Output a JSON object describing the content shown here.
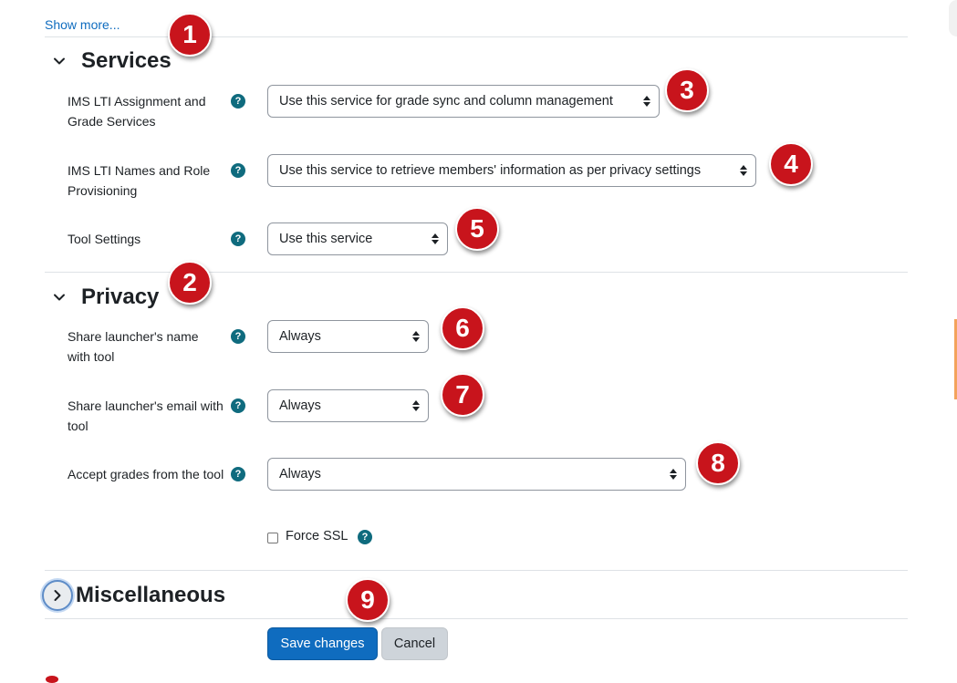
{
  "show_more": "Show more...",
  "sections": {
    "services": {
      "title": "Services"
    },
    "privacy": {
      "title": "Privacy"
    },
    "misc": {
      "title": "Miscellaneous"
    }
  },
  "services": {
    "grade_services": {
      "label": "IMS LTI Assignment and Grade Services",
      "value": "Use this service for grade sync and column management"
    },
    "names_roles": {
      "label": "IMS LTI Names and Role Provisioning",
      "value": "Use this service to retrieve members' information as per privacy settings"
    },
    "tool_settings": {
      "label": "Tool Settings",
      "value": "Use this service"
    }
  },
  "privacy": {
    "share_name": {
      "label": "Share launcher's name with tool",
      "value": "Always"
    },
    "share_email": {
      "label": "Share launcher's email with tool",
      "value": "Always"
    },
    "accept_grades": {
      "label": "Accept grades from the tool",
      "value": "Always"
    },
    "force_ssl": {
      "label": "Force SSL",
      "checked": false
    }
  },
  "help_glyph": "?",
  "buttons": {
    "save": "Save changes",
    "cancel": "Cancel"
  },
  "badges": [
    "1",
    "2",
    "3",
    "4",
    "5",
    "6",
    "7",
    "8",
    "9"
  ],
  "colors": {
    "accent": "#0f6cbf",
    "badge": "#c8141c",
    "help": "#0f6b7e"
  }
}
